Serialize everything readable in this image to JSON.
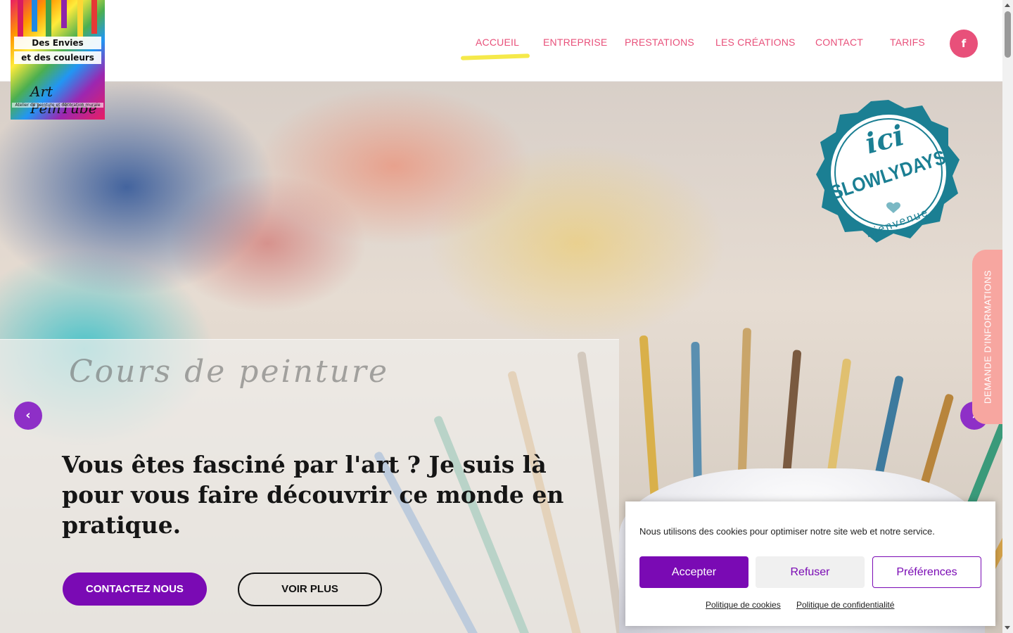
{
  "logo": {
    "line1": "Des Envies",
    "line2": "et des couleurs",
    "brand": "Art PeinTube",
    "sub": "Atelier de peinture et décoration murale"
  },
  "nav": {
    "items": [
      {
        "label": "ACCUEIL"
      },
      {
        "label": "ENTREPRISE"
      },
      {
        "label": "PRESTATIONS"
      },
      {
        "label": "LES CRÉATIONS"
      },
      {
        "label": "CONTACT"
      },
      {
        "label": "TARIFS"
      }
    ],
    "active": "ACCUEIL",
    "facebook_icon": "f"
  },
  "colors": {
    "nav_text": "#e8507a",
    "accent_purple": "#7a0ab4",
    "arrow_purple": "#8e2fc7",
    "underline_yellow": "#f5e94a",
    "side_tab": "#f7a6a0",
    "badge_teal": "#1b7f93"
  },
  "hero": {
    "script": "Cours de peinture",
    "title": "Vous êtes fasciné par l'art ? Je suis là pour vous faire découvrir ce monde en pratique.",
    "btn_contact": "CONTACTEZ NOUS",
    "btn_more": "VOIR PLUS",
    "arrow_left": "‹",
    "arrow_right": "›"
  },
  "badge": {
    "line1": "ici",
    "line2": "SLOWLYDAYS",
    "line3": "Bienvenue"
  },
  "side_tab": {
    "label": "DEMANDE D'INFORMATIONS"
  },
  "cookie": {
    "text": "Nous utilisons des cookies pour optimiser notre site web et notre service.",
    "accept": "Accepter",
    "refuse": "Refuser",
    "prefs": "Préférences",
    "link1": "Politique de cookies",
    "link2": "Politique de confidentialité"
  }
}
